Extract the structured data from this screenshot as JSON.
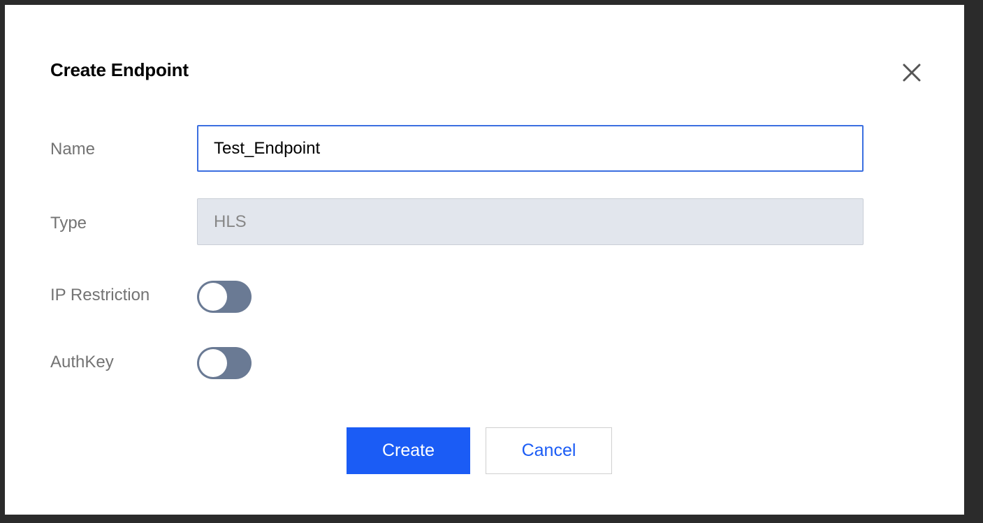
{
  "dialog": {
    "title": "Create Endpoint",
    "close_icon": "close-icon"
  },
  "form": {
    "name": {
      "label": "Name",
      "value": "Test_Endpoint"
    },
    "type": {
      "label": "Type",
      "value": "HLS"
    },
    "ip_restriction": {
      "label": "IP Restriction",
      "enabled": false
    },
    "authkey": {
      "label": "AuthKey",
      "enabled": false
    }
  },
  "actions": {
    "create_label": "Create",
    "cancel_label": "Cancel"
  },
  "colors": {
    "primary": "#1b5cf5",
    "input_focus_border": "#3b6fe0",
    "toggle_off": "#6a7a94",
    "disabled_bg": "#e2e6ed"
  }
}
